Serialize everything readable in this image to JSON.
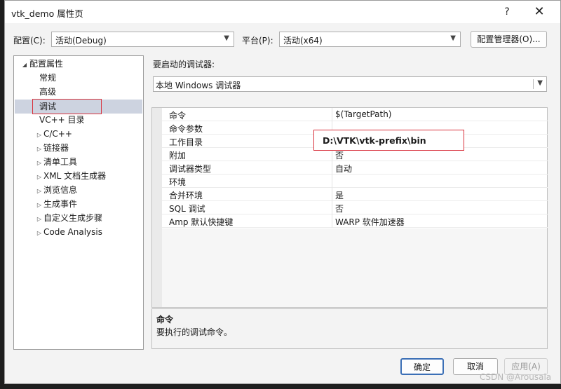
{
  "window": {
    "title": "vtk_demo 属性页",
    "help_glyph": "?",
    "close_glyph": "✕"
  },
  "toolbar": {
    "config_label": "配置(C):",
    "config_value": "活动(Debug)",
    "platform_label": "平台(P):",
    "platform_value": "活动(x64)",
    "config_manager_label": "配置管理器(O)..."
  },
  "tree": {
    "root": "配置属性",
    "items": [
      {
        "label": "常规",
        "expandable": false
      },
      {
        "label": "高级",
        "expandable": false
      },
      {
        "label": "调试",
        "expandable": false,
        "selected": true
      },
      {
        "label": "VC++ 目录",
        "expandable": false
      },
      {
        "label": "C/C++",
        "expandable": true
      },
      {
        "label": "链接器",
        "expandable": true
      },
      {
        "label": "清单工具",
        "expandable": true
      },
      {
        "label": "XML 文档生成器",
        "expandable": true
      },
      {
        "label": "浏览信息",
        "expandable": true
      },
      {
        "label": "生成事件",
        "expandable": true
      },
      {
        "label": "自定义生成步骤",
        "expandable": true
      },
      {
        "label": "Code Analysis",
        "expandable": true
      }
    ]
  },
  "debugger": {
    "label": "要启动的调试器:",
    "value": "本地 Windows 调试器"
  },
  "properties": [
    {
      "name": "命令",
      "value": "$(TargetPath)"
    },
    {
      "name": "命令参数",
      "value": ""
    },
    {
      "name": "工作目录",
      "value": ""
    },
    {
      "name": "附加",
      "value": "否"
    },
    {
      "name": "调试器类型",
      "value": "自动"
    },
    {
      "name": "环境",
      "value": ""
    },
    {
      "name": "合并环境",
      "value": "是"
    },
    {
      "name": "SQL 调试",
      "value": "否"
    },
    {
      "name": "Amp 默认快捷键",
      "value": "WARP 软件加速器"
    }
  ],
  "callout": {
    "text": "D:\\VTK\\vtk-prefix\\bin"
  },
  "description": {
    "title": "命令",
    "text": "要执行的调试命令。"
  },
  "buttons": {
    "ok": "确定",
    "cancel": "取消",
    "apply": "应用(A)"
  },
  "watermark": "CSDN @Arousala",
  "colors": {
    "highlight_border": "#d9313c",
    "selected_row": "#cdd3e0",
    "primary_button_border": "#3b6fb6"
  }
}
